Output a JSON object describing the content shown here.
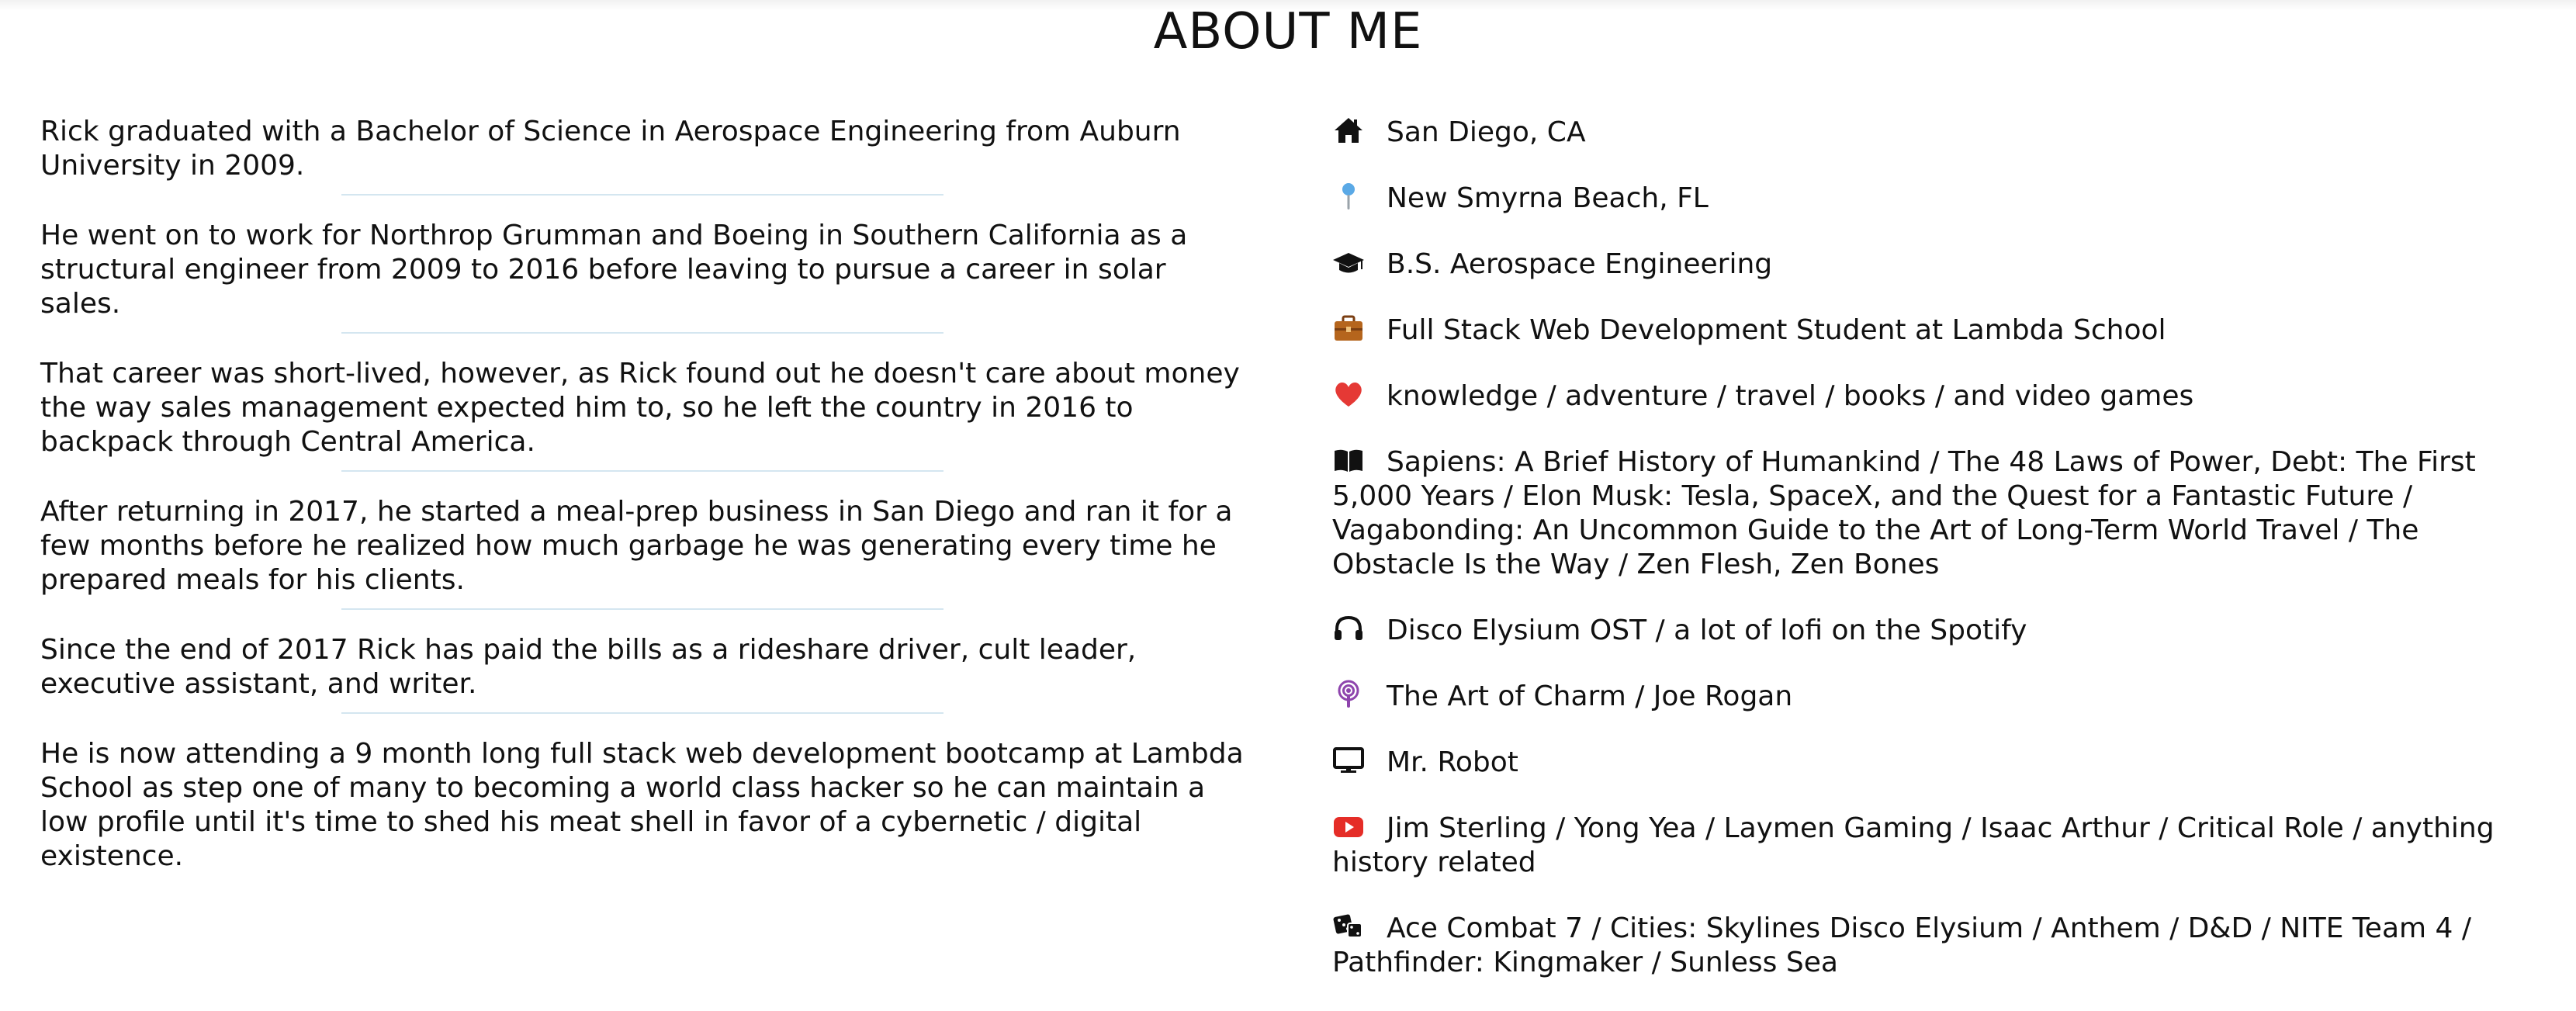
{
  "page": {
    "title": "ABOUT ME"
  },
  "bio": {
    "paragraphs": [
      "Rick graduated with a Bachelor of Science in Aerospace Engineering from Auburn University in 2009.",
      "He went on to work for Northrop Grumman and Boeing in Southern California as a structural engineer from 2009 to 2016 before leaving to pursue a career in solar sales.",
      "That career was short-lived, however, as Rick found out he doesn't care about money the way sales management expected him to, so he left the country in 2016 to backpack through Central America.",
      "After returning in 2017, he started a meal-prep business in San Diego and ran it for a few months before he realized how much garbage he was generating every time he prepared meals for his clients.",
      "Since the end of 2017 Rick has paid the bills as a rideshare driver, cult leader, executive assistant, and writer.",
      "He is now attending a 9 month long full stack web development bootcamp at Lambda School as step one of many to becoming a world class hacker so he can maintain a low profile until it's time to shed his meat shell in favor of a cybernetic / digital existence."
    ]
  },
  "facts": [
    {
      "icon": "home-icon",
      "text": "San Diego, CA"
    },
    {
      "icon": "pushpin-icon",
      "text": "New Smyrna Beach, FL"
    },
    {
      "icon": "graduation-cap-icon",
      "text": "B.S. Aerospace Engineering"
    },
    {
      "icon": "briefcase-icon",
      "text": "Full Stack Web Development Student at Lambda School"
    },
    {
      "icon": "heart-icon",
      "text": "knowledge / adventure / travel / books / and video games"
    },
    {
      "icon": "book-icon",
      "text": "Sapiens: A Brief History of Humankind / The 48 Laws of Power, Debt: The First 5,000 Years / Elon Musk: Tesla, SpaceX, and the Quest for a Fantastic Future / Vagabonding: An Uncommon Guide to the Art of Long-Term World Travel / The Obstacle Is the Way / Zen Flesh, Zen Bones"
    },
    {
      "icon": "headphones-icon",
      "text": "Disco Elysium OST / a lot of lofi on the Spotify"
    },
    {
      "icon": "podcast-icon",
      "text": "The Art of Charm / Joe Rogan"
    },
    {
      "icon": "tv-icon",
      "text": "Mr. Robot"
    },
    {
      "icon": "youtube-icon",
      "text": "Jim Sterling / Yong Yea / Laymen Gaming / Isaac Arthur / Critical Role / anything history related"
    },
    {
      "icon": "dice-icon",
      "text": "Ace Combat 7 / Cities: Skylines Disco Elysium / Anthem / D&D / NITE Team 4 / Pathfinder: Kingmaker / Sunless Sea"
    }
  ],
  "colors": {
    "text": "#111111",
    "divider": "#d4e6f0",
    "pushpin": "#5aa9e6",
    "briefcase": "#b5651d",
    "heart": "#e53935",
    "podcast": "#8e44ad",
    "youtube": "#e52d27"
  }
}
